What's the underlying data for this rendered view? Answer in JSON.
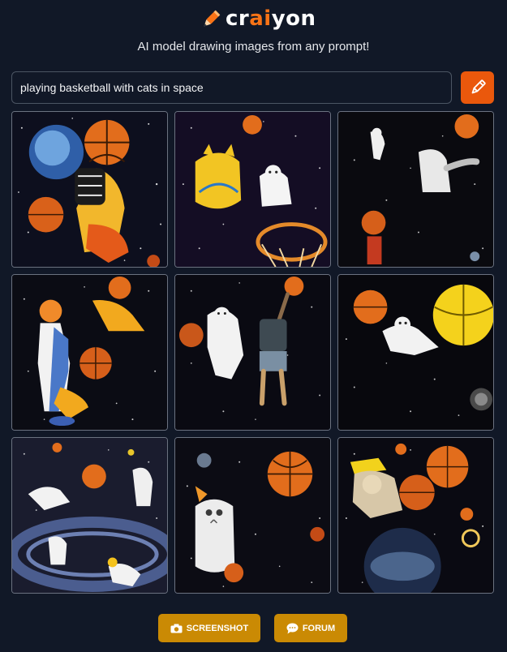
{
  "app": {
    "logo_prefix": "cr",
    "logo_accent": "ai",
    "logo_suffix": "yon",
    "tagline": "AI model drawing images from any prompt!"
  },
  "prompt": {
    "value": "playing basketball with cats in space",
    "submit_icon": "pencil-icon"
  },
  "results": {
    "images": [
      {
        "id": 1,
        "subject": "cat-player-dunking"
      },
      {
        "id": 2,
        "subject": "cats-with-hoop"
      },
      {
        "id": 3,
        "subject": "floating-cats"
      },
      {
        "id": 4,
        "subject": "cat-dribbling"
      },
      {
        "id": 5,
        "subject": "cats-reaching-ball"
      },
      {
        "id": 6,
        "subject": "cat-under-planet"
      },
      {
        "id": 7,
        "subject": "cats-on-rings"
      },
      {
        "id": 8,
        "subject": "kitten-with-ball"
      },
      {
        "id": 9,
        "subject": "cat-above-planet"
      }
    ]
  },
  "actions": {
    "screenshot_label": "SCREENSHOT",
    "screenshot_icon": "camera-icon",
    "forum_label": "FORUM",
    "forum_icon": "chat-bubble-icon"
  },
  "colors": {
    "background": "#111827",
    "brand_accent": "#f97316",
    "draw_button": "#ea580c",
    "action_button": "#ca8a04",
    "space": "#0b0b12",
    "basketball": "#e26d1c"
  }
}
